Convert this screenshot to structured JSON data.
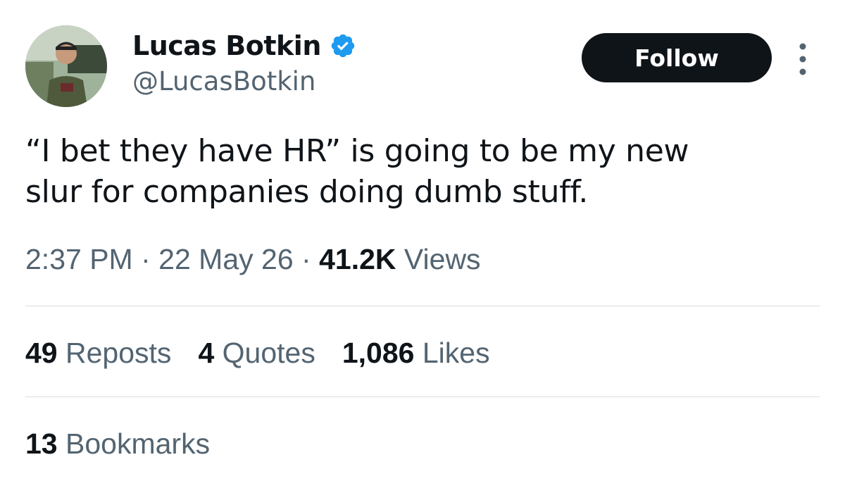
{
  "author": {
    "display_name": "Lucas Botkin",
    "handle": "@LucasBotkin",
    "verified": true,
    "verified_color": "#1d9bf0",
    "avatar_icon": "profile-photo"
  },
  "actions": {
    "follow_label": "Follow",
    "more_icon": "more-vertical-icon"
  },
  "tweet": {
    "text_lines": [
      "“I bet they have HR” is going to be my new",
      "slur for companies doing dumb stuff."
    ]
  },
  "meta": {
    "time": "2:37 PM",
    "separator": "·",
    "date": "22 May 26",
    "views_count": "41.2K",
    "views_label": "Views"
  },
  "stats": {
    "reposts_count": "49",
    "reposts_label": "Reposts",
    "quotes_count": "4",
    "quotes_label": "Quotes",
    "likes_count": "1,086",
    "likes_label": "Likes",
    "bookmarks_count": "13",
    "bookmarks_label": "Bookmarks"
  },
  "colors": {
    "text_primary": "#0f1419",
    "text_secondary": "#536471",
    "divider": "#d7dde2",
    "button_bg": "#0f1419"
  }
}
